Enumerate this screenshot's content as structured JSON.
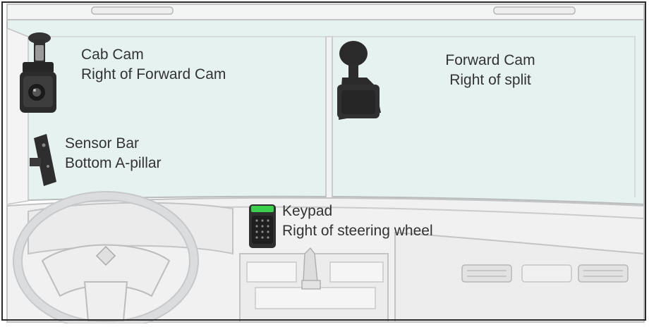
{
  "colors": {
    "glass": "#e8f3f1",
    "outline": "#c2c4c6",
    "device_dark": "#2a2a2a",
    "keypad_accent": "#3ccf4e",
    "text": "#333333"
  },
  "devices": [
    {
      "id": "cab-cam",
      "icon": "camera-icon",
      "title": "Cab Cam",
      "subtitle": "Right of Forward Cam"
    },
    {
      "id": "forward-cam",
      "icon": "suction-mount-camera-icon",
      "title": "Forward Cam",
      "subtitle": "Right of split"
    },
    {
      "id": "sensor-bar",
      "icon": "sensor-bar-icon",
      "title": "Sensor Bar",
      "subtitle": "Bottom A-pillar"
    },
    {
      "id": "keypad",
      "icon": "keypad-icon",
      "title": "Keypad",
      "subtitle": "Right of steering wheel"
    }
  ]
}
